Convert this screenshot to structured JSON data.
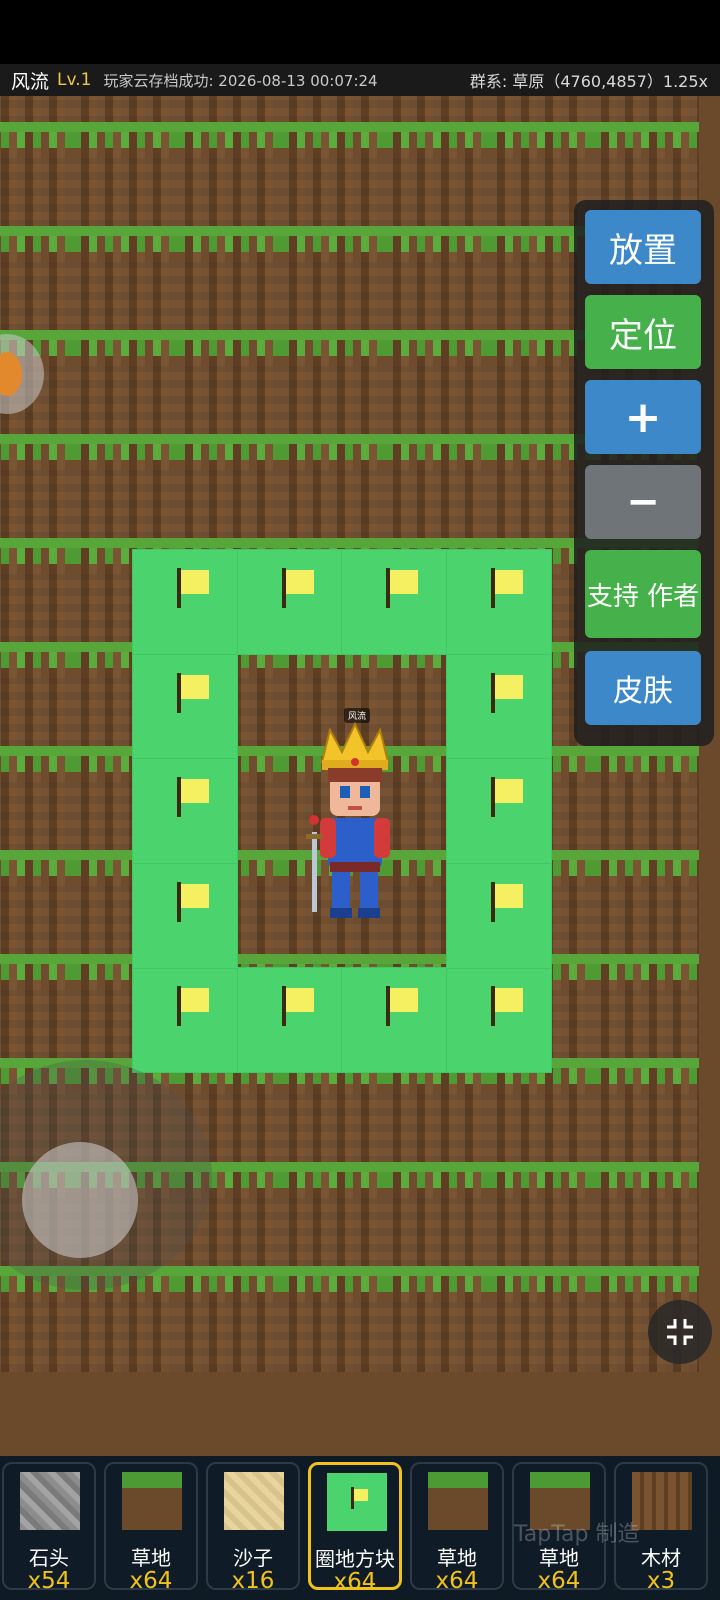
{
  "topbar": {
    "player_name": "风流",
    "level": "Lv.1",
    "save_status": "玩家云存档成功: 2026-08-13 00:07:24",
    "biome_info": "群系: 草原（4760,4857）1.25x"
  },
  "side_buttons": {
    "place": "放置",
    "locate": "定位",
    "zoom_in": "+",
    "zoom_out": "−",
    "support": "支持 作者",
    "skin": "皮肤"
  },
  "player": {
    "name_tag": "风流"
  },
  "hotbar": {
    "selected_index": 3,
    "slots": [
      {
        "label": "石头",
        "count": "x54",
        "icon": "stone-block-icon"
      },
      {
        "label": "草地",
        "count": "x64",
        "icon": "grass-block-icon"
      },
      {
        "label": "沙子",
        "count": "x16",
        "icon": "sand-block-icon"
      },
      {
        "label": "圈地方块",
        "count": "x64",
        "icon": "claim-block-icon"
      },
      {
        "label": "草地",
        "count": "x64",
        "icon": "grass-block-icon"
      },
      {
        "label": "草地",
        "count": "x64",
        "icon": "grass-block-icon"
      },
      {
        "label": "木材",
        "count": "x3",
        "icon": "wood-block-icon"
      }
    ]
  },
  "watermark": "TapTap 制造",
  "colors": {
    "claim_green": "#4bd46e",
    "button_blue": "#3d88c8",
    "button_green": "#46b04a",
    "selected_gold": "#f2c21c"
  }
}
